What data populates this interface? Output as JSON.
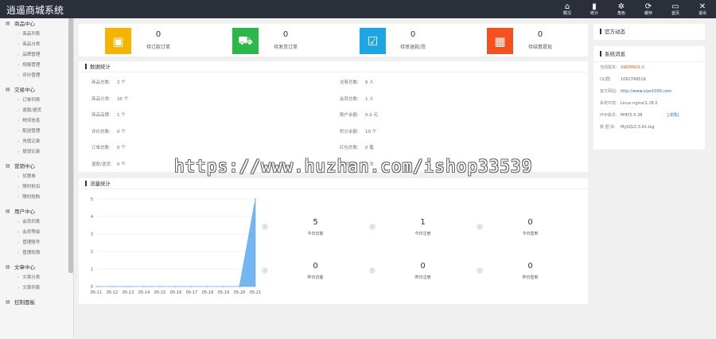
{
  "app": {
    "title": "逍遥商城系统"
  },
  "topnav": [
    {
      "label": "概况",
      "icon": "home-icon",
      "glyph": "⌂"
    },
    {
      "label": "统计",
      "icon": "bar-chart-icon",
      "glyph": "▮"
    },
    {
      "label": "角色",
      "icon": "gear-icon",
      "glyph": "✲"
    },
    {
      "label": "缓存",
      "icon": "refresh-icon",
      "glyph": "⟳"
    },
    {
      "label": "首页",
      "icon": "monitor-icon",
      "glyph": "▭"
    },
    {
      "label": "退出",
      "icon": "close-icon",
      "glyph": "✕"
    }
  ],
  "sidebar": [
    {
      "title": "商品中心",
      "icon": "grid-icon",
      "items": [
        "商品列表",
        "商品分类",
        "品牌管理",
        "规格管理",
        "评价管理"
      ]
    },
    {
      "title": "交易中心",
      "icon": "file-icon",
      "items": [
        "订单列表",
        "退款/退货",
        "物流信息",
        "配送管理",
        "充值记录",
        "提现记录"
      ]
    },
    {
      "title": "营销中心",
      "icon": "tag-icon",
      "items": [
        "优惠券",
        "限时折扣",
        "限时抢购"
      ]
    },
    {
      "title": "用户中心",
      "icon": "user-icon",
      "items": [
        "会员列表",
        "会员等级",
        "管理账号",
        "管理权限"
      ]
    },
    {
      "title": "文章中心",
      "icon": "article-icon",
      "items": [
        "文章分类",
        "文章列表"
      ]
    },
    {
      "title": "控制面板",
      "icon": "settings-icon",
      "items": []
    }
  ],
  "stats": [
    {
      "value": "0",
      "label": "待订款订单",
      "color": "#f5b400",
      "icon": "wallet-icon",
      "glyph": "▣"
    },
    {
      "value": "0",
      "label": "待发货订单",
      "color": "#2cb74a",
      "icon": "truck-icon",
      "glyph": "⛟"
    },
    {
      "value": "0",
      "label": "待审退款/货",
      "color": "#1ea5e6",
      "icon": "calendar-check-icon",
      "glyph": "☑"
    },
    {
      "value": "0",
      "label": "待结算提现",
      "color": "#f4511e",
      "icon": "calculator-icon",
      "glyph": "▦"
    }
  ],
  "data_stats": {
    "title": "数据统计",
    "rows": [
      [
        {
          "label": "商品总数:",
          "value": "2 个"
        },
        {
          "label": "访客总数:",
          "value": "6 人"
        }
      ],
      [
        {
          "label": "商品分类:",
          "value": "35 个"
        },
        {
          "label": "会员总数:",
          "value": "1 人"
        }
      ],
      [
        {
          "label": "商品品牌:",
          "value": "1 个"
        },
        {
          "label": "账户余额:",
          "value": "0.0 元"
        }
      ],
      [
        {
          "label": "评价总数:",
          "value": "0 个"
        },
        {
          "label": "积分余额:",
          "value": "10 个"
        }
      ],
      [
        {
          "label": "订单总数:",
          "value": "0 个"
        },
        {
          "label": "红包总数:",
          "value": "0 笔"
        }
      ],
      [
        {
          "label": "退款/退货:",
          "value": "0 个"
        },
        {
          "label": "提现总数:",
          "value": "0 次"
        }
      ]
    ]
  },
  "right": {
    "news_title": "官方动态",
    "sys_title": "系统消息",
    "sys": [
      {
        "label": "当前版本:",
        "value": "XIAOYAO1.0",
        "color": "#e8590c"
      },
      {
        "label": "QQ群:",
        "value": "1062749519",
        "color": "#666666"
      },
      {
        "label": "官方网站:",
        "value": "http://www.xiye1000.com",
        "color": "#1e6fb8"
      },
      {
        "label": "系统环境:",
        "value": "Linux nginx/1.18.0",
        "color": "#666666"
      },
      {
        "label": "PHP版本:",
        "value": "PHP/5.5.38",
        "extra": "[详情]",
        "color": "#666666"
      },
      {
        "label": "数 据 库:",
        "value": "MySQL5.5.61-log",
        "color": "#666666"
      }
    ]
  },
  "traffic": {
    "title": "流量统计",
    "cells": [
      {
        "value": "5",
        "label": "今日访客"
      },
      {
        "value": "1",
        "label": "今日注册"
      },
      {
        "value": "0",
        "label": "今日签到"
      },
      {
        "value": "0",
        "label": "昨日访客"
      },
      {
        "value": "0",
        "label": "昨日注册"
      },
      {
        "value": "0",
        "label": "昨日签到"
      }
    ],
    "dash": "–"
  },
  "chart_data": {
    "type": "area",
    "title": "",
    "categories": [
      "05-11",
      "05-12",
      "05-13",
      "05-14",
      "05-15",
      "05-16",
      "05-17",
      "05-18",
      "05-19",
      "05-20",
      "05-21"
    ],
    "series": [
      {
        "values": [
          0,
          0,
          0,
          0,
          0,
          0,
          0,
          0,
          0,
          0,
          5
        ]
      }
    ],
    "ylim": [
      0,
      5
    ],
    "yticks": [
      "0",
      "1",
      "2",
      "3",
      "4",
      "5"
    ],
    "grid": true,
    "legend": "none",
    "fill_color": "#5aa9f0"
  },
  "watermark": "https://www.huzhan.com/ishop33539"
}
